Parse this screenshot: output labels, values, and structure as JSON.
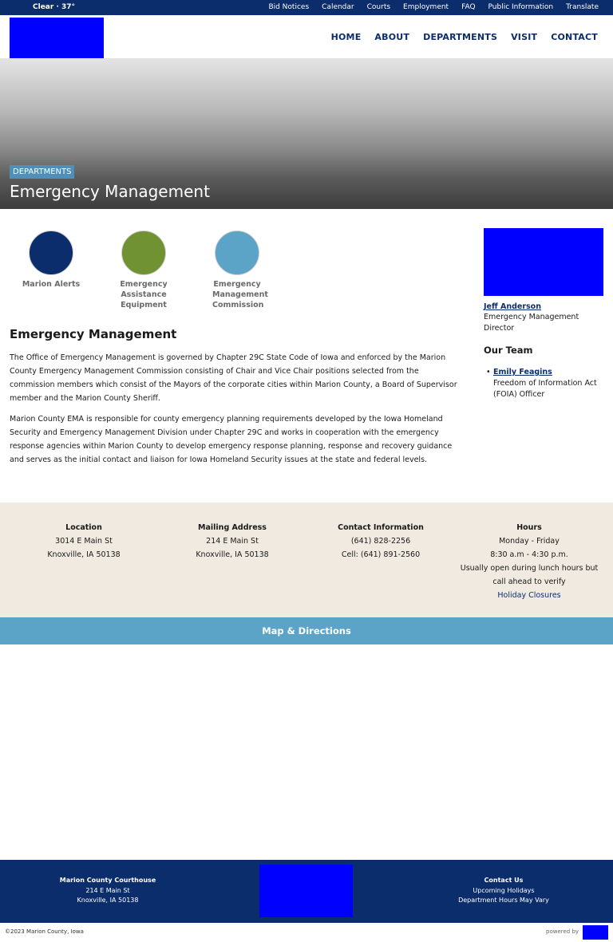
{
  "topbar": {
    "weather": "Clear · 37°",
    "links": [
      "Bid Notices",
      "Calendar",
      "Courts",
      "Employment",
      "FAQ",
      "Public Information",
      "Translate"
    ]
  },
  "nav": {
    "items": [
      "HOME",
      "ABOUT",
      "DEPARTMENTS",
      "VISIT",
      "CONTACT"
    ]
  },
  "hero": {
    "tag": "DEPARTMENTS",
    "title": "Emergency Management"
  },
  "quick_links": [
    {
      "label": "Marion Alerts",
      "color": "#0c2d6b"
    },
    {
      "label": "Emergency Assistance Equipment",
      "color": "#709232"
    },
    {
      "label": "Emergency Management Commission",
      "color": "#5ba4c8"
    }
  ],
  "content": {
    "heading": "Emergency Management",
    "paragraphs": [
      "The Office of Emergency Management is governed by Chapter 29C State Code of Iowa and enforced by the Marion County Emergency Management Commission consisting of Chair and Vice Chair positions selected from the commission members which consist of the Mayors of the corporate cities within Marion County, a Board of Supervisor member and the Marion County Sheriff.",
      "Marion County EMA is responsible for county emergency planning requirements developed by the Iowa Homeland Security and Emergency Management Division under Chapter 29C and works in cooperation with the emergency response agencies within Marion County to develop emergency response planning, response and recovery guidance and serves as the initial contact and liaison for Iowa Homeland Security issues at the state and federal levels."
    ]
  },
  "sidebar": {
    "director_name": "Jeff Anderson",
    "director_title": "Emergency Management Director",
    "team_heading": "Our Team",
    "members": [
      {
        "name": "Emily Feagins",
        "title": "Freedom of Information Act (FOIA) Officer"
      }
    ]
  },
  "info": {
    "location": {
      "heading": "Location",
      "line1": "3014 E Main St",
      "line2": "Knoxville, IA 50138"
    },
    "mailing": {
      "heading": "Mailing Address",
      "line1": "214 E Main St",
      "line2": "Knoxville, IA 50138"
    },
    "contact": {
      "heading": "Contact Information",
      "line1": "(641) 828-2256",
      "line2": "Cell: (641) 891-2560"
    },
    "hours": {
      "heading": "Hours",
      "line1": "Monday - Friday",
      "line2": "8:30 a.m - 4:30 p.m.",
      "line3": "Usually open during lunch hours but call ahead to verify",
      "link": "Holiday Closures"
    }
  },
  "map": {
    "label": "Map & Directions"
  },
  "footer": {
    "left_heading": "Marion County Courthouse",
    "left_line1": "214 E Main St",
    "left_line2": "Knoxville, IA 50138",
    "right_heading": "Contact Us",
    "right_line1": "Upcoming Holidays",
    "right_line2": "Department Hours May Vary",
    "copyright": "©2023 Marion County, Iowa",
    "powered": "powered by"
  },
  "colors": {
    "brand_navy": "#0c2d6b",
    "accent_blue": "#5ba4c8",
    "footer_beige": "#f0eae1"
  }
}
